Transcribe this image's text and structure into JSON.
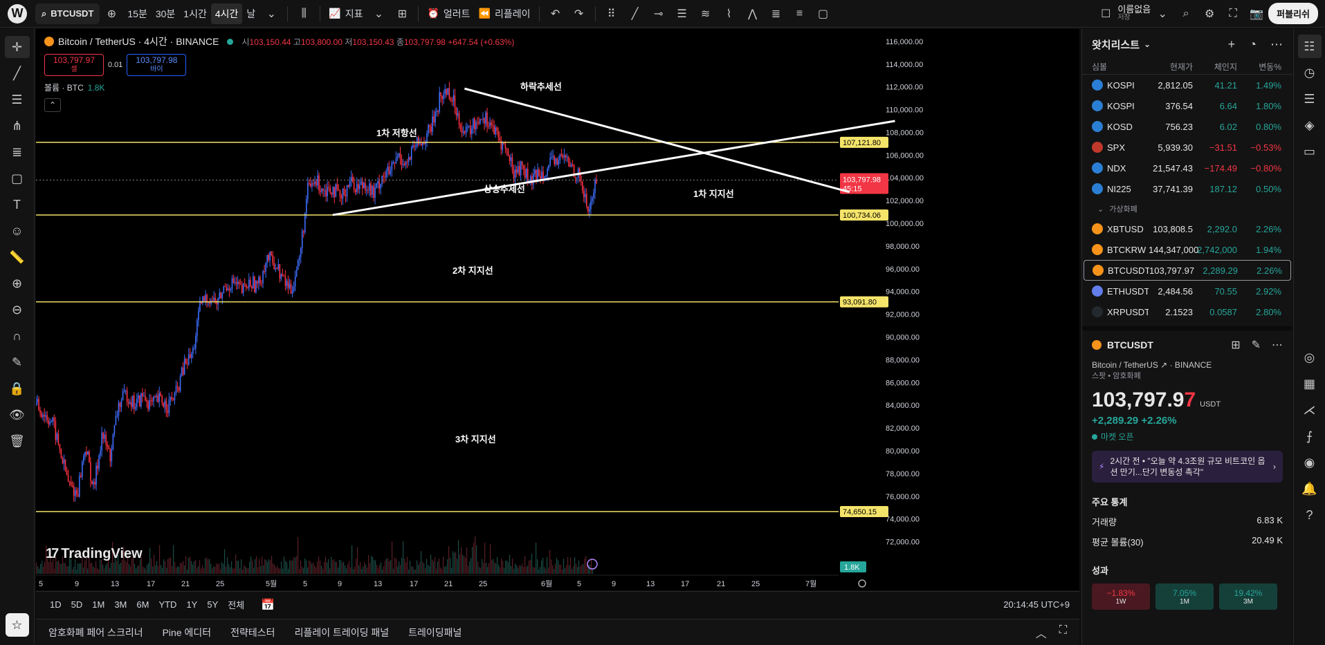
{
  "topbar": {
    "logo": "W",
    "symbol": "BTCUSDT",
    "intervals": [
      "15분",
      "30분",
      "1시간",
      "4시간",
      "날"
    ],
    "active_interval": "4시간",
    "indicators_label": "지표",
    "alert_label": "얼러트",
    "replay_label": "리플레이",
    "layout_name": "이름없음",
    "layout_status": "저장",
    "publish_label": "퍼블리쉬"
  },
  "chart": {
    "title": "Bitcoin / TetherUS · 4시간 · BINANCE",
    "ohlc_open_label": "시",
    "ohlc_open": "103,150.44",
    "ohlc_high_label": "고",
    "ohlc_high": "103,800.00",
    "ohlc_low_label": "저",
    "ohlc_low": "103,150.43",
    "ohlc_close_label": "종",
    "ohlc_close": "103,797.98",
    "ohlc_change": "+647.54 (+0.63%)",
    "sell_price": "103,797.97",
    "sell_label": "셀",
    "spread": "0.01",
    "buy_price": "103,797.98",
    "buy_label": "바이",
    "volume_label": "볼륨 · BTC",
    "volume_value": "1.8K",
    "watermark": "TradingView",
    "annotations": {
      "downtrend": "하락추세선",
      "uptrend": "상승추세선",
      "resistance1": "1차 저항선",
      "support1": "1차 지지선",
      "support2": "2차 지지선",
      "support3": "3차 지지선"
    },
    "price_badges": {
      "resistance1": "107,121.80",
      "current": "103,797.98",
      "countdown": "45:15",
      "support1": "100,734.06",
      "support2": "93,091.80",
      "support3": "74,650.15",
      "volume": "1.8K"
    }
  },
  "chart_data": {
    "type": "candlestick",
    "symbol": "BTCUSDT",
    "y_axis_ticks": [
      "116,000.00",
      "114,000.00",
      "112,000.00",
      "110,000.00",
      "108,000.00",
      "106,000.00",
      "104,000.00",
      "102,000.00",
      "100,000.00",
      "98,000.00",
      "96,000.00",
      "94,000.00",
      "92,000.00",
      "90,000.00",
      "88,000.00",
      "86,000.00",
      "84,000.00",
      "82,000.00",
      "80,000.00",
      "78,000.00",
      "76,000.00",
      "74,000.00",
      "72,000.00"
    ],
    "ylim": [
      71000,
      116600
    ],
    "x_axis_ticks": [
      "5",
      "9",
      "13",
      "17",
      "21",
      "25",
      "5월",
      "5",
      "9",
      "13",
      "17",
      "21",
      "25",
      "6월",
      "5",
      "9",
      "13",
      "17",
      "21",
      "25",
      "7월"
    ],
    "horizontal_levels": [
      107121.8,
      100734.06,
      93091.8,
      74650.15
    ],
    "current_price": 103797.98,
    "trendlines": {
      "downtrend": [
        [
          52,
          111850
        ],
        [
          71,
          102750
        ]
      ],
      "uptrend": [
        [
          36,
          100734
        ],
        [
          74,
          109000
        ]
      ]
    },
    "price_path": [
      [
        0,
        84000
      ],
      [
        2,
        82500
      ],
      [
        4,
        77000
      ],
      [
        5,
        76200
      ],
      [
        6,
        80500
      ],
      [
        7,
        76500
      ],
      [
        8,
        81500
      ],
      [
        9,
        79500
      ],
      [
        10,
        84000
      ],
      [
        11,
        85000
      ],
      [
        12,
        84000
      ],
      [
        13,
        84800
      ],
      [
        14,
        84000
      ],
      [
        15,
        84500
      ],
      [
        16,
        84000
      ],
      [
        17,
        85000
      ],
      [
        18,
        87500
      ],
      [
        19,
        88500
      ],
      [
        20,
        93000
      ],
      [
        21,
        93500
      ],
      [
        22,
        93000
      ],
      [
        23,
        94500
      ],
      [
        24,
        94800
      ],
      [
        25,
        94000
      ],
      [
        26,
        94800
      ],
      [
        27,
        94500
      ],
      [
        28,
        97000
      ],
      [
        29,
        96500
      ],
      [
        30,
        95000
      ],
      [
        31,
        94200
      ],
      [
        32,
        97000
      ],
      [
        33,
        103000
      ],
      [
        34,
        103700
      ],
      [
        35,
        103000
      ],
      [
        36,
        103200
      ],
      [
        37,
        102000
      ],
      [
        38,
        103800
      ],
      [
        39,
        103200
      ],
      [
        40,
        103600
      ],
      [
        41,
        102500
      ],
      [
        42,
        104200
      ],
      [
        43,
        104500
      ],
      [
        44,
        106000
      ],
      [
        45,
        105200
      ],
      [
        46,
        106800
      ],
      [
        47,
        107200
      ],
      [
        48,
        108500
      ],
      [
        49,
        111000
      ],
      [
        50,
        111800
      ],
      [
        51,
        110000
      ],
      [
        52,
        107800
      ],
      [
        53,
        108500
      ],
      [
        54,
        109500
      ],
      [
        55,
        109000
      ],
      [
        56,
        107500
      ],
      [
        57,
        106500
      ],
      [
        58,
        104500
      ],
      [
        59,
        105000
      ],
      [
        60,
        103500
      ],
      [
        61,
        104500
      ],
      [
        62,
        104800
      ],
      [
        63,
        105500
      ],
      [
        64,
        105800
      ],
      [
        65,
        105000
      ],
      [
        66,
        104000
      ],
      [
        67,
        101000
      ],
      [
        68,
        103800
      ]
    ],
    "grid": false
  },
  "timeframes": [
    "1D",
    "5D",
    "1M",
    "3M",
    "6M",
    "YTD",
    "1Y",
    "5Y",
    "전체"
  ],
  "clock": "20:14:45 UTC+9",
  "bottom_tabs": [
    "암호화폐 페어 스크리너",
    "Pine 에디터",
    "전략테스터",
    "리플레이 트레이딩 패널",
    "트레이딩패널"
  ],
  "watchlist": {
    "title": "왓치리스트",
    "columns": [
      "심볼",
      "현재가",
      "체인지",
      "변동%"
    ],
    "rows": [
      {
        "sym": "KOSPI",
        "last": "2,812.05",
        "chg": "41.21",
        "pct": "1.49%",
        "dir": "up",
        "color": "#2a7fd4"
      },
      {
        "sym": "KOSPI",
        "last": "376.54",
        "chg": "6.64",
        "pct": "1.80%",
        "dir": "up",
        "color": "#2a7fd4"
      },
      {
        "sym": "KOSD",
        "last": "756.23",
        "chg": "6.02",
        "pct": "0.80%",
        "dir": "up",
        "color": "#2a7fd4"
      },
      {
        "sym": "SPX",
        "last": "5,939.30",
        "chg": "−31.51",
        "pct": "−0.53%",
        "dir": "dn",
        "color": "#c0392b"
      },
      {
        "sym": "NDX",
        "last": "21,547.43",
        "chg": "−174.49",
        "pct": "−0.80%",
        "dir": "dn",
        "color": "#2a7fd4"
      },
      {
        "sym": "NI225",
        "last": "37,741.39",
        "chg": "187.12",
        "pct": "0.50%",
        "dir": "up",
        "color": "#2a7fd4"
      }
    ],
    "crypto_group": "가상화폐",
    "crypto_rows": [
      {
        "sym": "XBTUSD",
        "last": "103,808.5",
        "chg": "2,292.0",
        "pct": "2.26%",
        "dir": "up",
        "color": "#f7931a"
      },
      {
        "sym": "BTCKRW",
        "last": "144,347,000",
        "chg": "2,742,000",
        "pct": "1.94%",
        "dir": "up",
        "color": "#f7931a"
      },
      {
        "sym": "BTCUSDT",
        "last": "103,797.97",
        "chg": "2,289.29",
        "pct": "2.26%",
        "dir": "up",
        "color": "#f7931a"
      },
      {
        "sym": "ETHUSDT",
        "last": "2,484.56",
        "chg": "70.55",
        "pct": "2.92%",
        "dir": "up",
        "color": "#627eea"
      },
      {
        "sym": "XRPUSDT",
        "last": "2.1523",
        "chg": "0.0587",
        "pct": "2.80%",
        "dir": "up",
        "color": "#23292f"
      }
    ]
  },
  "details": {
    "symbol": "BTCUSDT",
    "name": "Bitcoin / TetherUS",
    "exchange": "BINANCE",
    "type": "스팟 • 암호화폐",
    "price_main": "103,797.9",
    "price_last": "7",
    "currency": "USDT",
    "change": "+2,289.29  +2.26%",
    "market_status": "마켓 오픈",
    "news": "2시간 전 • \"오늘 약 4.3조원 규모 비트코인 옵션 만기...단기 변동성 촉각\"",
    "stats_title": "주요 통계",
    "volume_label": "거래량",
    "volume_value": "6.83 K",
    "avg_volume_label": "평균 볼륨(30)",
    "avg_volume_value": "20.49 K",
    "perf_title": "성과",
    "perf": [
      {
        "value": "−1.83%",
        "label": "1W",
        "dir": "neg"
      },
      {
        "value": "7.05%",
        "label": "1M",
        "dir": "pos"
      },
      {
        "value": "19.42%",
        "label": "3M",
        "dir": "pos"
      }
    ]
  }
}
